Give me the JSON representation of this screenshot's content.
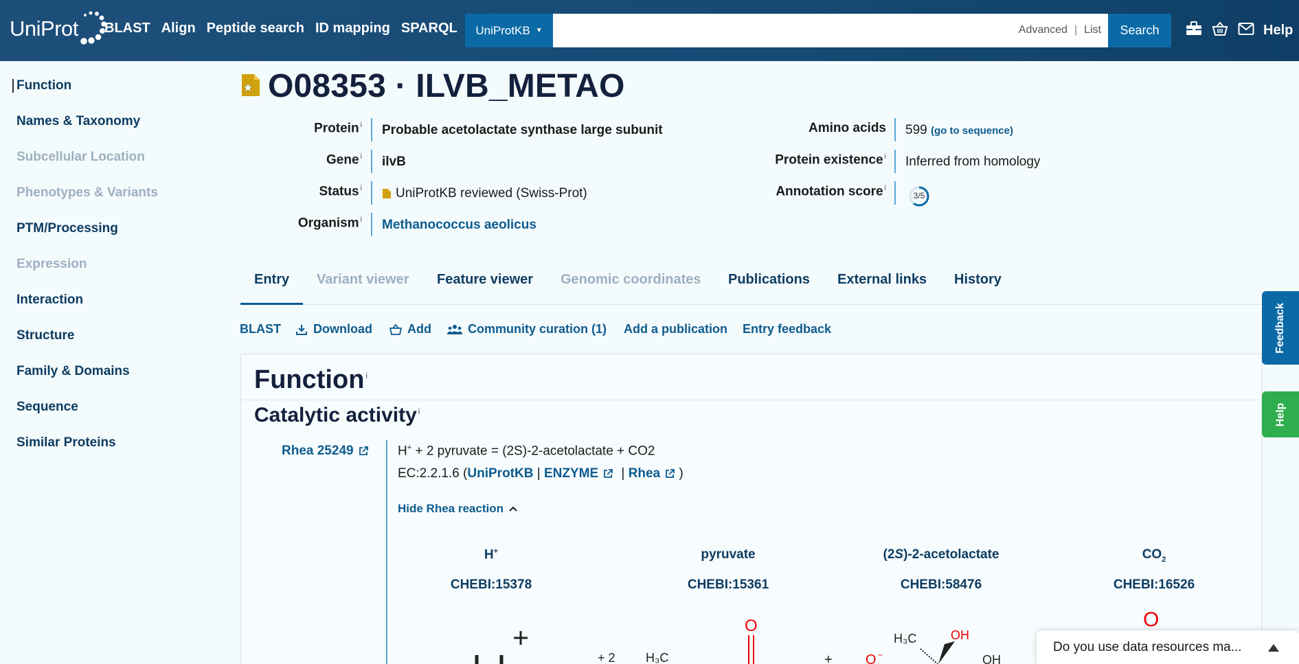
{
  "header": {
    "logo_text": "UniProt",
    "nav": [
      "BLAST",
      "Align",
      "Peptide search",
      "ID mapping",
      "SPARQL"
    ],
    "search": {
      "db_label": "UniProtKB",
      "placeholder": "",
      "advanced_label": "Advanced",
      "list_label": "List",
      "button_label": "Search"
    },
    "icons": [
      "toolbox-icon",
      "basket-icon",
      "mail-icon"
    ],
    "help_label": "Help"
  },
  "sidebar": {
    "items": [
      {
        "label": "Function",
        "enabled": true
      },
      {
        "label": "Names & Taxonomy",
        "enabled": true
      },
      {
        "label": "Subcellular Location",
        "enabled": false
      },
      {
        "label": "Phenotypes & Variants",
        "enabled": false
      },
      {
        "label": "PTM/Processing",
        "enabled": true
      },
      {
        "label": "Expression",
        "enabled": false
      },
      {
        "label": "Interaction",
        "enabled": true
      },
      {
        "label": "Structure",
        "enabled": true
      },
      {
        "label": "Family & Domains",
        "enabled": true
      },
      {
        "label": "Sequence",
        "enabled": true
      },
      {
        "label": "Similar Proteins",
        "enabled": true
      }
    ]
  },
  "entry": {
    "title": "O08353 · ILVB_METAO",
    "protein_label": "Protein",
    "protein_value": "Probable acetolactate synthase large subunit",
    "gene_label": "Gene",
    "gene_value": "ilvB",
    "status_label": "Status",
    "status_value": "UniProtKB reviewed (Swiss-Prot)",
    "organism_label": "Organism",
    "organism_value": "Methanococcus aeolicus",
    "amino_label": "Amino acids",
    "amino_value": "599",
    "amino_link": "(go to sequence)",
    "existence_label": "Protein existence",
    "existence_value": "Inferred from homology",
    "score_label": "Annotation score",
    "score_value": "3/5",
    "score_fraction": 0.6,
    "info_marker": "i"
  },
  "tabs": [
    {
      "label": "Entry",
      "enabled": true,
      "active": true
    },
    {
      "label": "Variant viewer",
      "enabled": false
    },
    {
      "label": "Feature viewer",
      "enabled": true
    },
    {
      "label": "Genomic coordinates",
      "enabled": false
    },
    {
      "label": "Publications",
      "enabled": true
    },
    {
      "label": "External links",
      "enabled": true
    },
    {
      "label": "History",
      "enabled": true
    }
  ],
  "toolbar": {
    "blast": "BLAST",
    "download": "Download",
    "add": "Add",
    "community": "Community curation (1)",
    "add_publication": "Add a publication",
    "feedback": "Entry feedback"
  },
  "function": {
    "title": "Function",
    "catalytic_title": "Catalytic activity",
    "rhea_link": "Rhea 25249",
    "reaction_main": "H",
    "reaction_rest": " + 2 pyruvate = (2S)-2-acetolactate + CO2",
    "ec_prefix": "EC:2.2.1.6 (",
    "ec_uniprot": "UniProtKB",
    "ec_sep1": " | ",
    "ec_enzyme": "ENZYME",
    "ec_sep2": " | ",
    "ec_rhea": "Rhea",
    "ec_suffix": " )",
    "hide_rhea": "Hide Rhea reaction",
    "participants": [
      {
        "name": "H",
        "chebi": "CHEBI:15378"
      },
      {
        "name": "pyruvate",
        "chebi": "CHEBI:15361"
      },
      {
        "name": "-2-acetolactate",
        "chebi": "CHEBI:58476"
      },
      {
        "name": "CO",
        "chebi": "CHEBI:16526"
      }
    ]
  },
  "side_tabs": {
    "feedback": "Feedback",
    "help": "Help"
  },
  "survey": {
    "text": "Do you use data resources ma..."
  },
  "colors": {
    "header": "#164a74",
    "accent": "#0b6aa6",
    "link": "#0d5b8f",
    "help_tab": "#2fae4e"
  }
}
